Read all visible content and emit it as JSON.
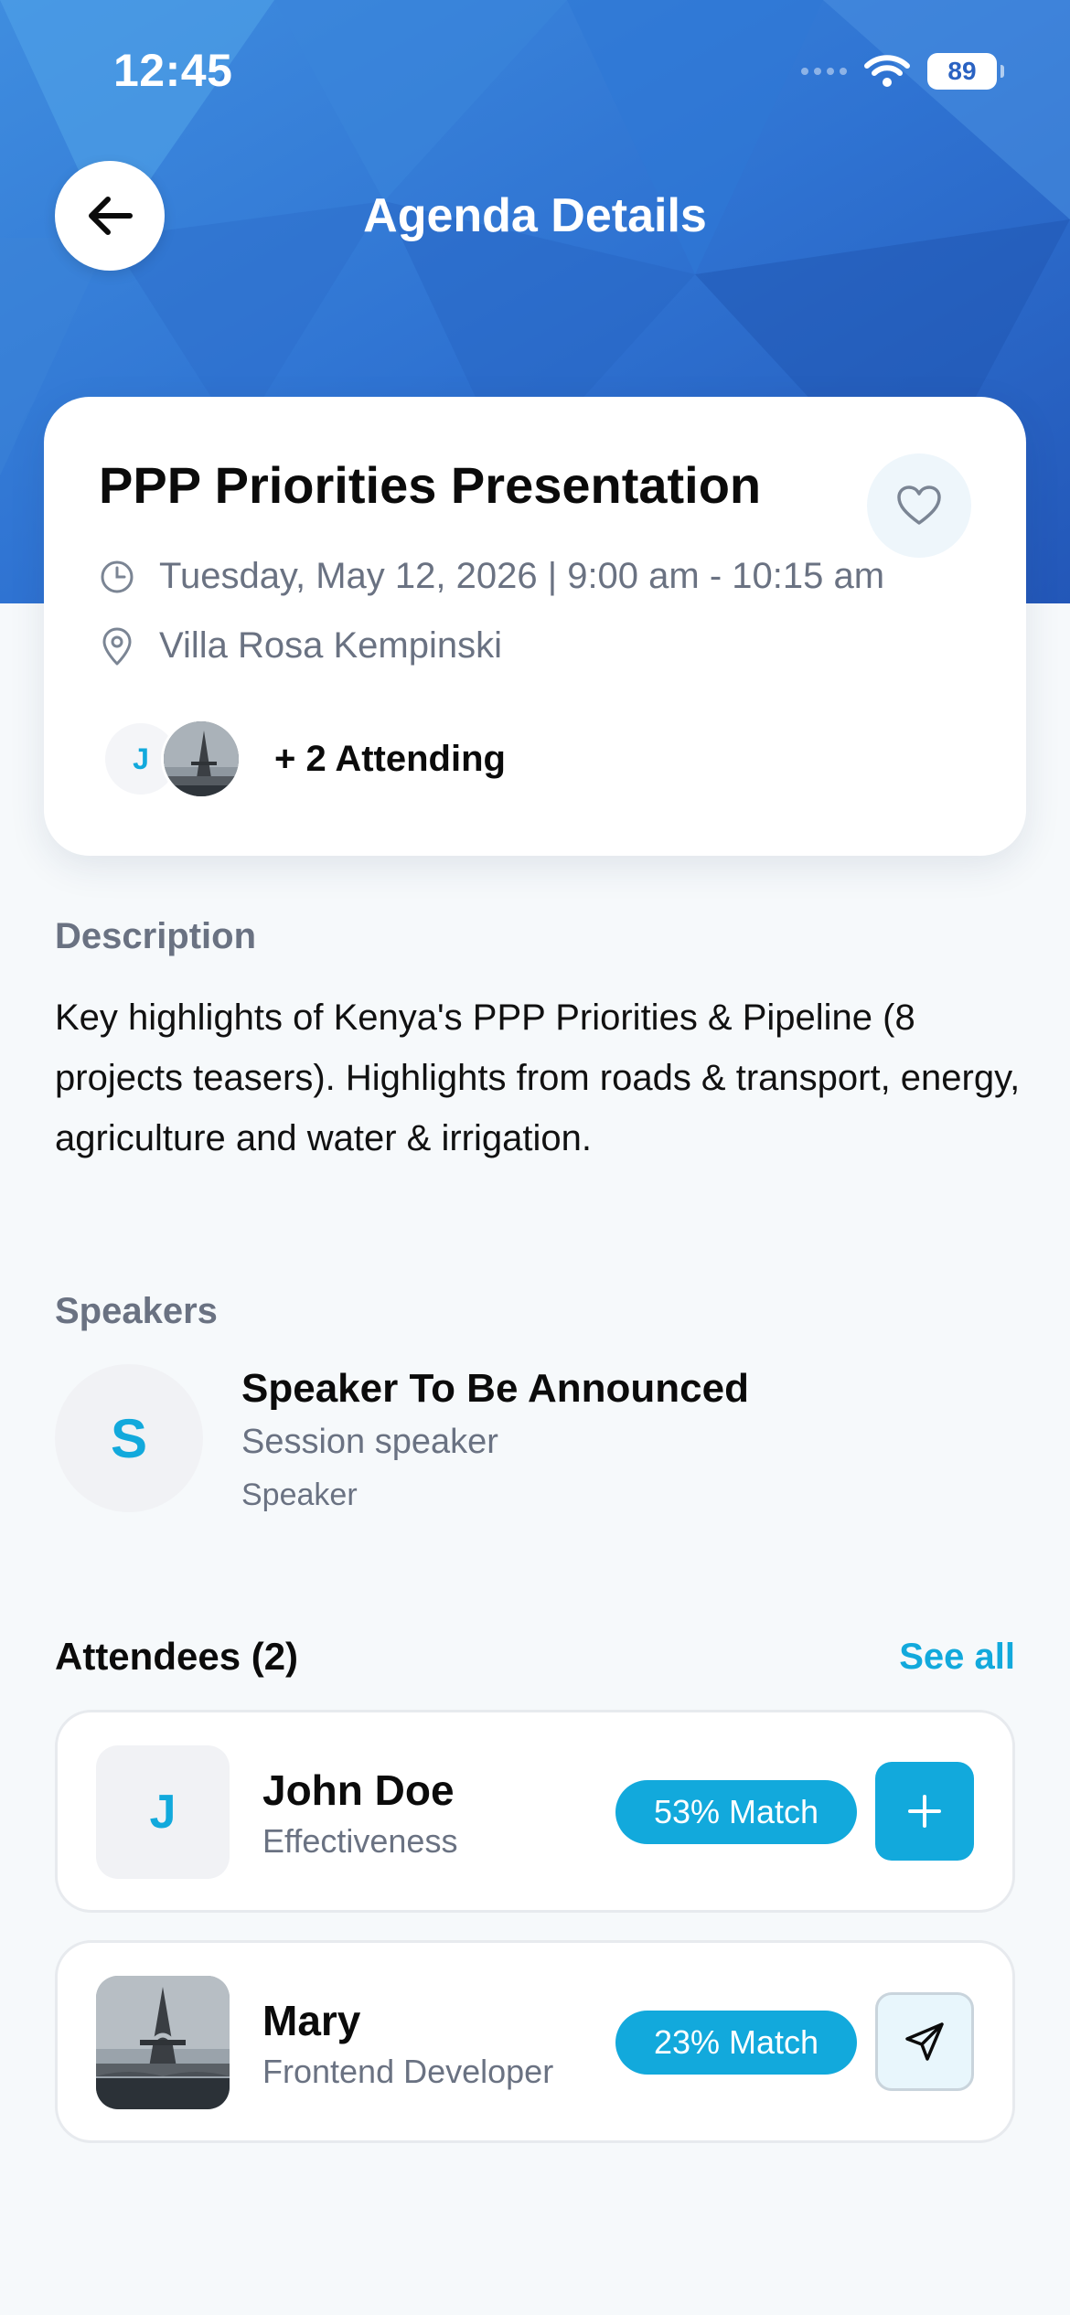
{
  "status_bar": {
    "time": "12:45",
    "battery": "89",
    "icons": [
      "signal-icon",
      "wifi-icon",
      "battery-icon"
    ]
  },
  "header": {
    "title": "Agenda Details",
    "back_icon": "arrow-left-icon"
  },
  "event": {
    "title": "PPP Priorities Presentation",
    "datetime": "Tuesday, May 12, 2026 | 9:00 am - 10:15 am",
    "location": "Villa Rosa Kempinski",
    "attending_text": "+ 2 Attending",
    "attendee_initial": "J",
    "icons": [
      "heart-icon",
      "clock-icon",
      "map-pin-icon"
    ]
  },
  "description": {
    "label": "Description",
    "text": "Key highlights of Kenya's PPP Priorities & Pipeline (8 projects teasers). Highlights from roads & transport, energy, agriculture and water & irrigation."
  },
  "speakers": {
    "label": "Speakers",
    "items": [
      {
        "initial": "S",
        "name": "Speaker To Be Announced",
        "role": "Session speaker",
        "type": "Speaker"
      }
    ]
  },
  "attendees": {
    "title": "Attendees (2)",
    "see_all": "See all",
    "items": [
      {
        "initial": "J",
        "name": "John Doe",
        "role": "Effectiveness",
        "match": "53% Match",
        "action": "plus-icon"
      },
      {
        "initial": "",
        "name": "Mary",
        "role": "Frontend Developer",
        "match": "23% Match",
        "action": "send-icon"
      }
    ]
  },
  "colors": {
    "accent": "#12a9dc",
    "header_blue": "#2f6fd0",
    "background": "#f6f9fb",
    "muted_text": "#6a7282"
  }
}
